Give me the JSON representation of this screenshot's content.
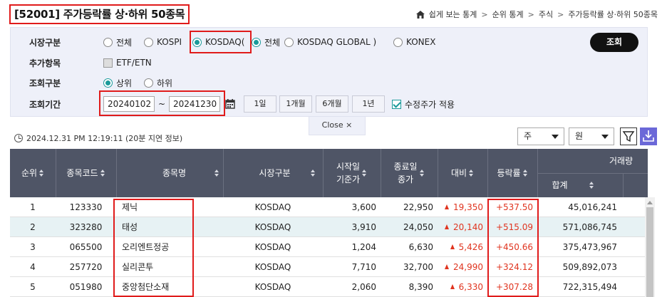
{
  "title": "[52001] 주가등락률 상·하위 50종목",
  "breadcrumb": [
    "쉽게 보는 통계",
    "순위 통계",
    "주식",
    "주가등락률 상·하위 50종목"
  ],
  "search": {
    "market_label": "시장구분",
    "market_options": [
      "전체",
      "KOSPI",
      "KOSDAQ(",
      "전체",
      "KOSDAQ GLOBAL )",
      "KONEX"
    ],
    "extra_label": "추가항목",
    "extra_option": "ETF/ETN",
    "rank_label": "조회구분",
    "rank_options": [
      "상위",
      "하위"
    ],
    "period_label": "조회기간",
    "start_date": "20240102",
    "tilde": "~",
    "end_date": "20241230",
    "periods": [
      "1일",
      "1개월",
      "6개월",
      "1년"
    ],
    "adjusted_label": "수정주가 적용",
    "search_button": "조회",
    "close_label": "Close  ×"
  },
  "info": {
    "timestamp": "2024.12.31 PM 12:19:11 (20분 지연 정보)",
    "unit_select": "주",
    "currency_select": "원"
  },
  "colors": {
    "accent": "#1a9a9a",
    "header_bg": "#4f5566",
    "up": "#e0341f",
    "highlight": "#e01b1b"
  },
  "table": {
    "headers": {
      "rank": "순위",
      "code": "종목코드",
      "name": "종목명",
      "market": "시장구분",
      "start_price": [
        "시작일",
        "기준가"
      ],
      "end_price": [
        "종료일",
        "종가"
      ],
      "change": "대비",
      "rate": "등락률",
      "volume": "거래량",
      "volume_total": "합계"
    },
    "rows": [
      {
        "rank": "1",
        "code": "123330",
        "name": "제닉",
        "market": "KOSDAQ",
        "start": "3,600",
        "end": "22,950",
        "change": "19,350",
        "rate": "+537.50",
        "volume": "45,016,241"
      },
      {
        "rank": "2",
        "code": "323280",
        "name": "태성",
        "market": "KOSDAQ",
        "start": "3,910",
        "end": "24,050",
        "change": "20,140",
        "rate": "+515.09",
        "volume": "571,086,745"
      },
      {
        "rank": "3",
        "code": "065500",
        "name": "오리엔트정공",
        "market": "KOSDAQ",
        "start": "1,204",
        "end": "6,630",
        "change": "5,426",
        "rate": "+450.66",
        "volume": "375,473,967"
      },
      {
        "rank": "4",
        "code": "257720",
        "name": "실리콘투",
        "market": "KOSDAQ",
        "start": "7,710",
        "end": "32,700",
        "change": "24,990",
        "rate": "+324.12",
        "volume": "509,892,073"
      },
      {
        "rank": "5",
        "code": "051980",
        "name": "중앙첨단소재",
        "market": "KOSDAQ",
        "start": "2,060",
        "end": "8,390",
        "change": "6,330",
        "rate": "+307.28",
        "volume": "722,315,494"
      }
    ]
  }
}
